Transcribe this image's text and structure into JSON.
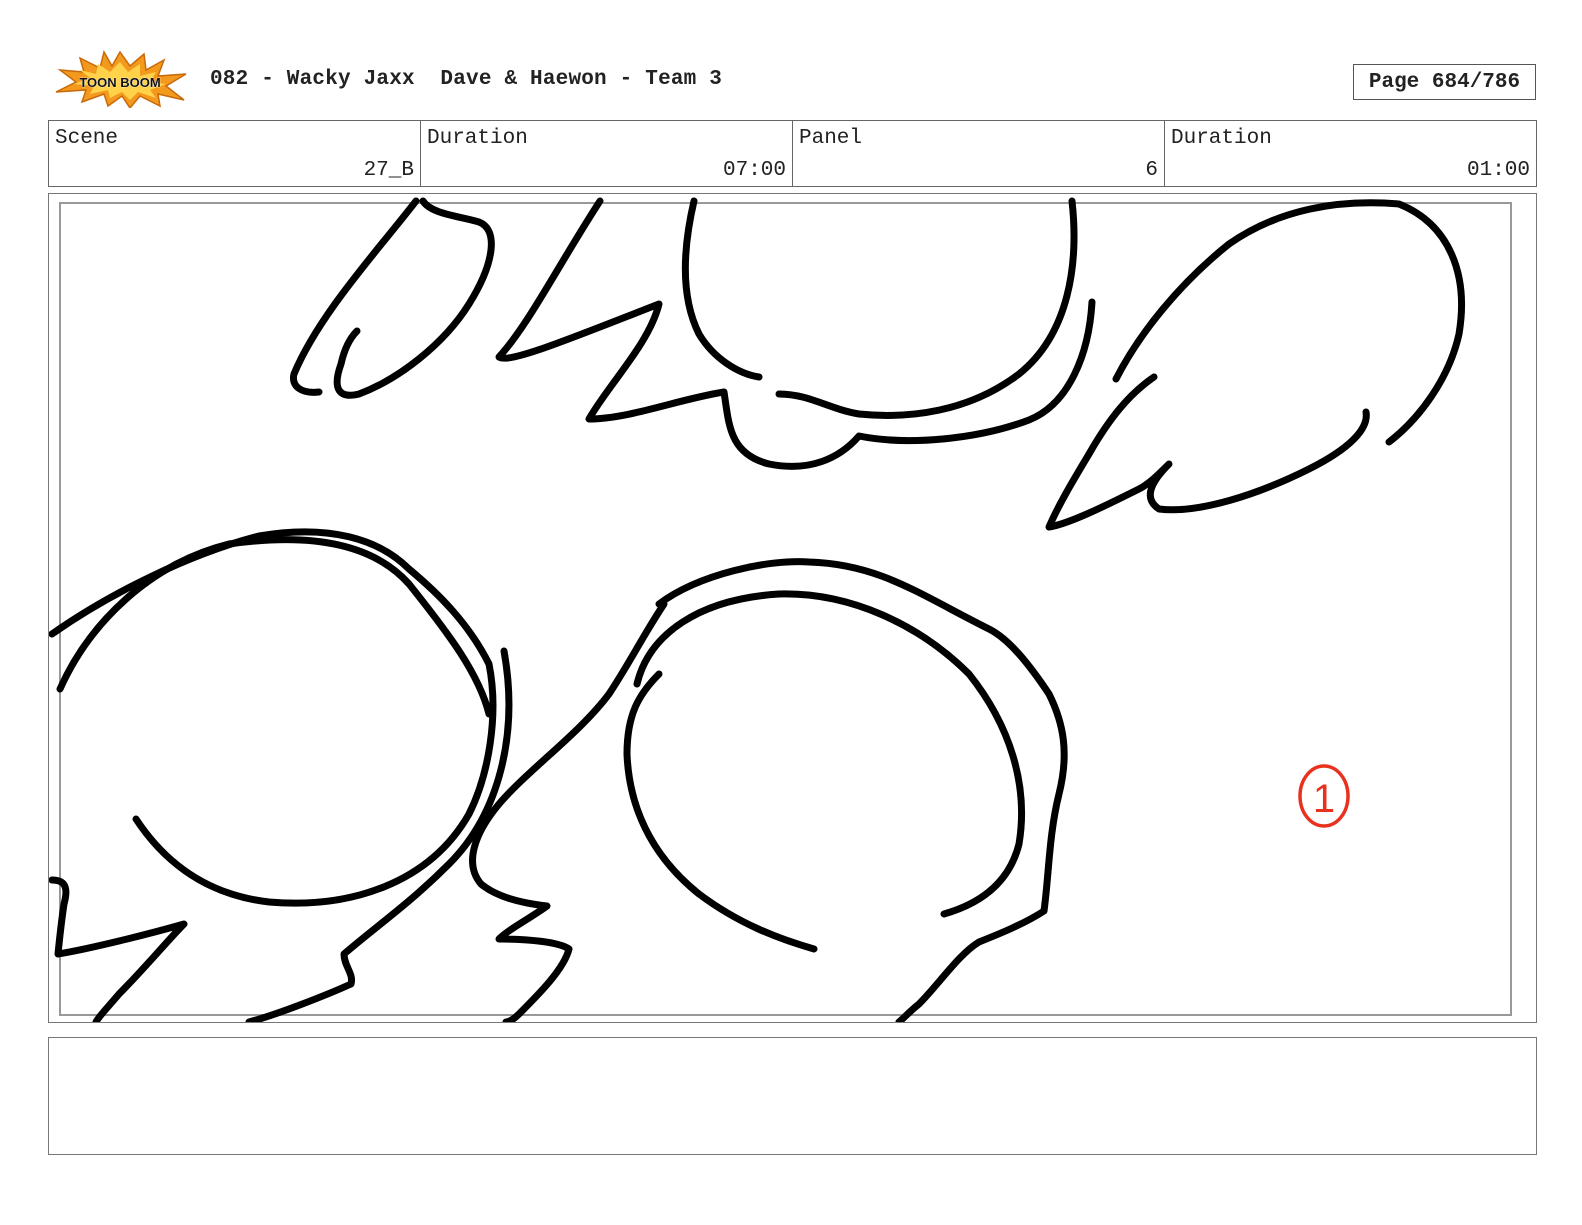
{
  "header": {
    "logo_text": "TOON BOOM",
    "title": "082 - Wacky Jaxx  Dave & Haewon - Team 3",
    "page": "Page 684/786"
  },
  "info": {
    "scene_label": "Scene",
    "scene_value": "27_B",
    "scene_duration_label": "Duration",
    "scene_duration_value": "07:00",
    "panel_label": "Panel",
    "panel_value": "6",
    "panel_duration_label": "Duration",
    "panel_duration_value": "01:00"
  },
  "panel": {
    "annotation": "1",
    "annotation_color": "#e8321e",
    "line_color": "#000000"
  },
  "notes": {
    "text": ""
  }
}
